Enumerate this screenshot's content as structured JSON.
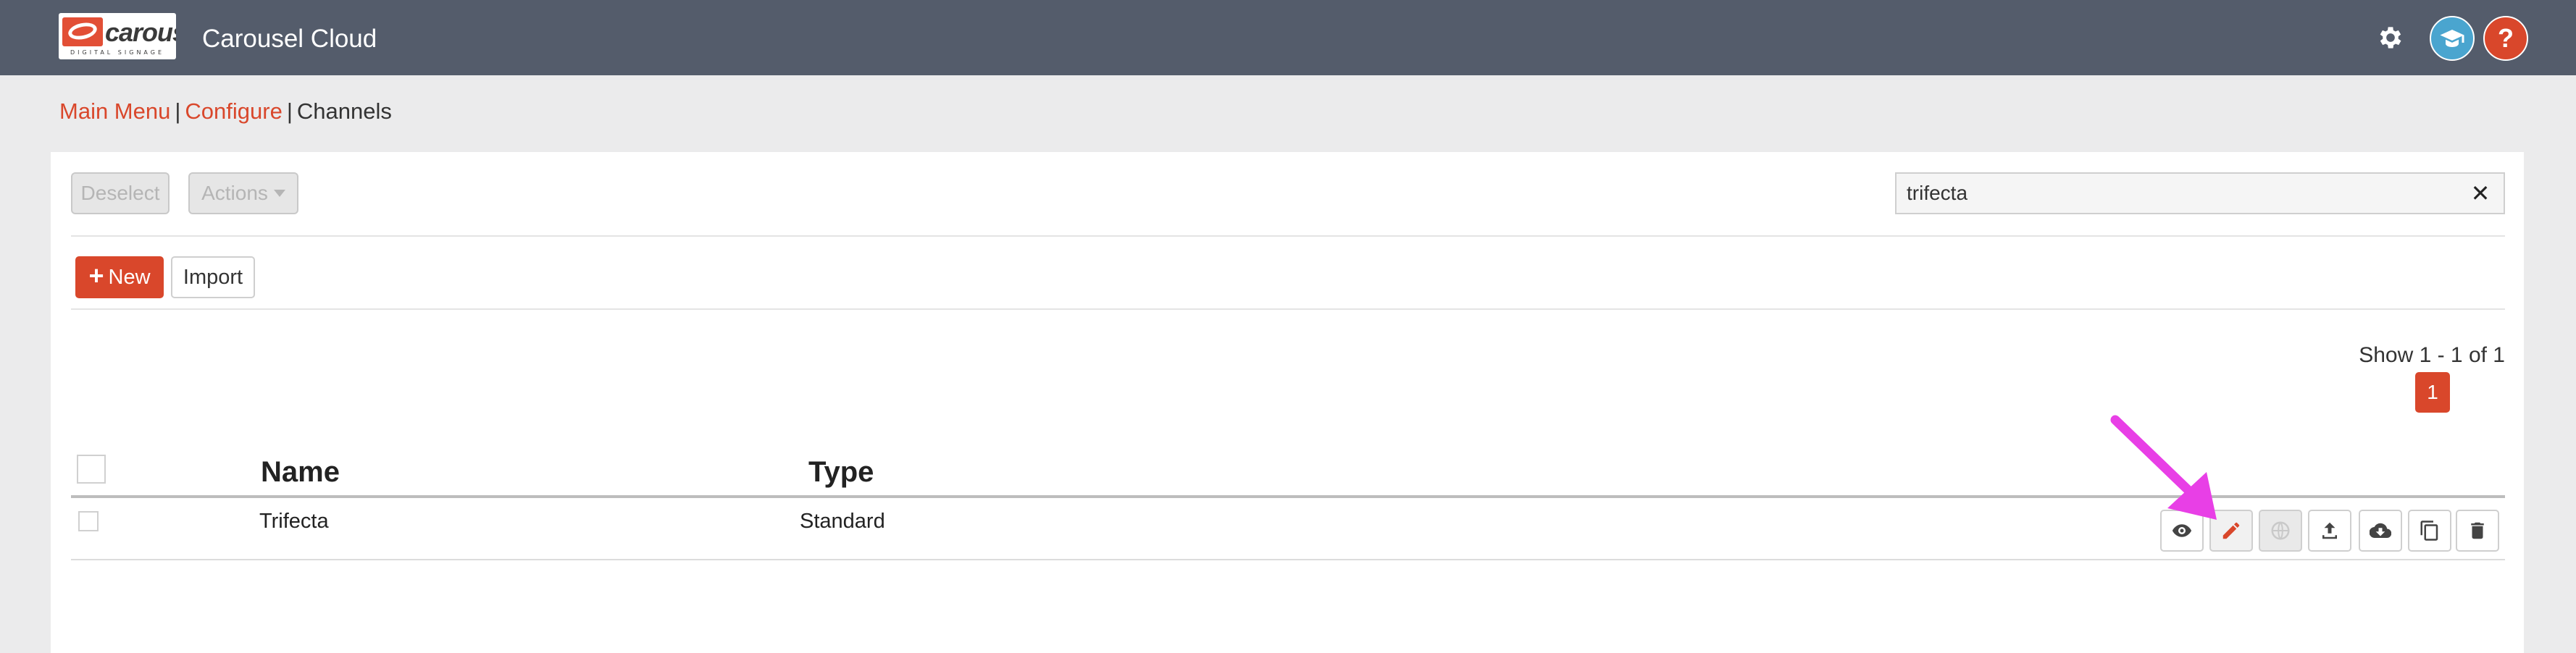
{
  "header": {
    "logo_text": "carousel",
    "logo_subtext": "DIGITAL SIGNAGE",
    "app_title": "Carousel Cloud",
    "help_label": "?"
  },
  "breadcrumb": {
    "main_menu": "Main Menu",
    "configure": "Configure",
    "channels": "Channels",
    "separator": "|"
  },
  "toolbar": {
    "deselect_label": "Deselect",
    "actions_label": "Actions",
    "search_value": "trifecta",
    "clear_label": "✕",
    "new_label": "New",
    "new_icon": "+",
    "import_label": "Import"
  },
  "pagination": {
    "showing": "Show 1 - 1 of 1",
    "current_page": "1"
  },
  "table": {
    "columns": [
      "Name",
      "Type"
    ],
    "rows": [
      {
        "name": "Trifecta",
        "type": "Standard"
      }
    ],
    "row_actions": [
      "eye-icon",
      "pencil-icon",
      "globe-icon",
      "upload-icon",
      "cloud-download-icon",
      "copy-icon",
      "trash-icon"
    ]
  },
  "colors": {
    "topbar": "#545c6b",
    "accent": "#d9472b",
    "academy": "#4aa5cf",
    "annotation_arrow": "#e83fe6"
  }
}
